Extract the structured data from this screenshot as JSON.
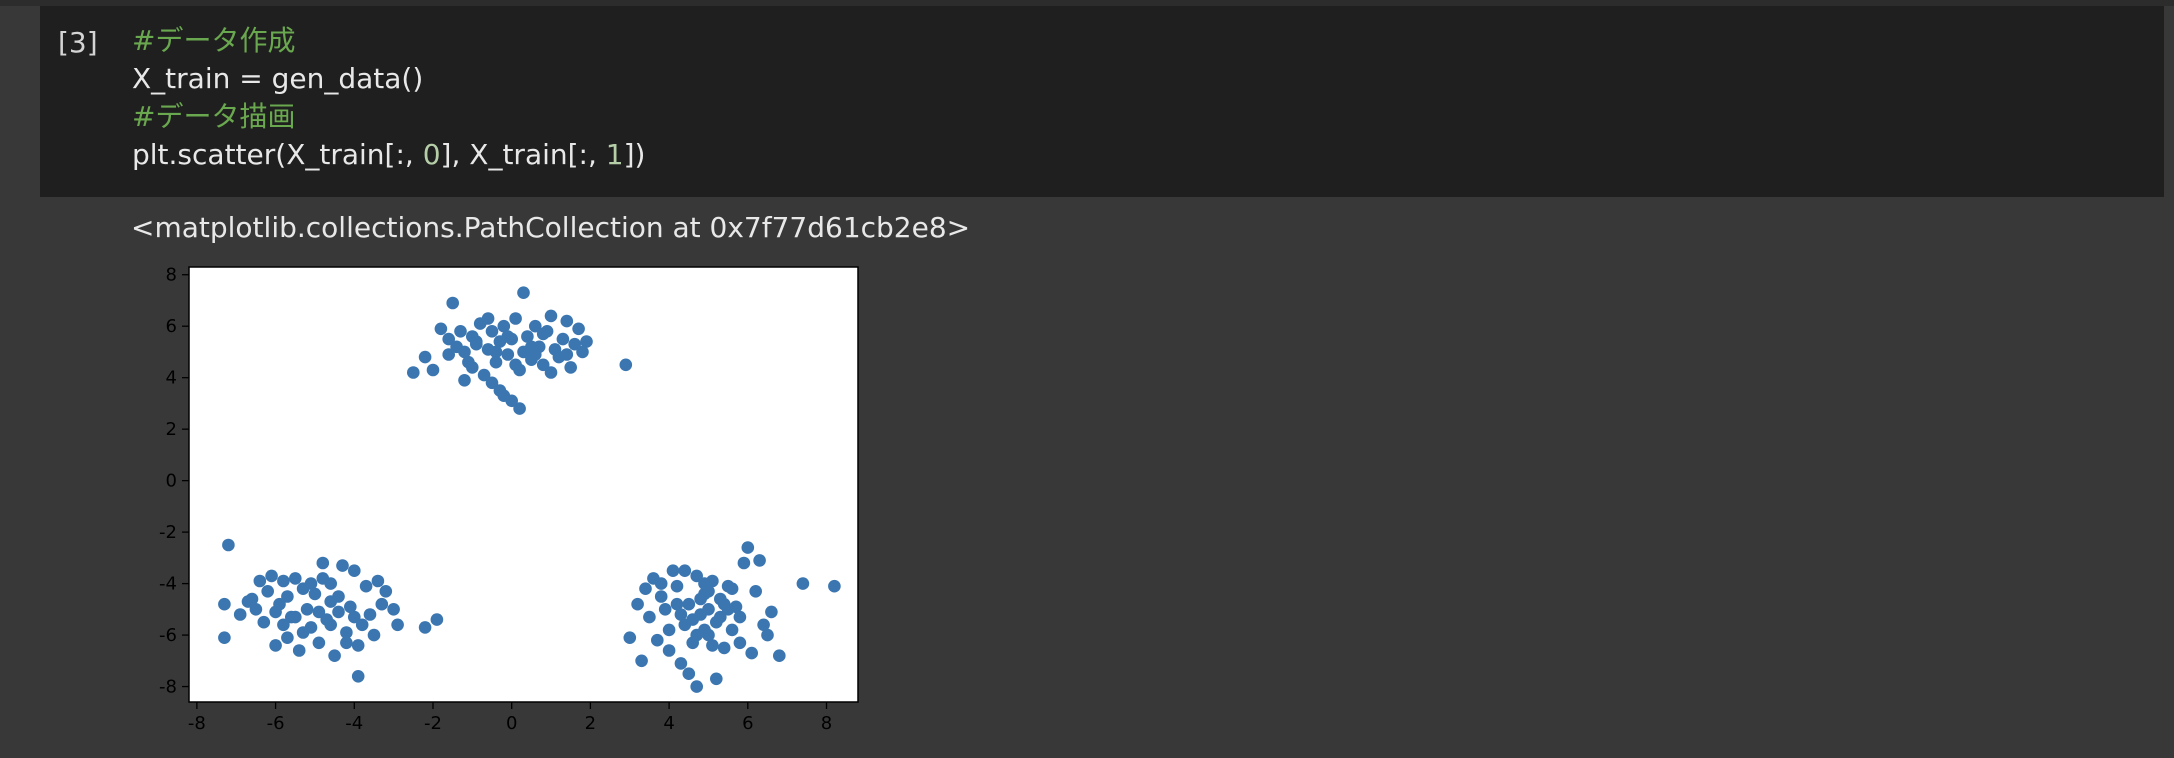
{
  "cell": {
    "execution_count": "[3]",
    "code_lines": [
      {
        "parts": [
          {
            "text": "#データ作成",
            "kind": "comment"
          }
        ]
      },
      {
        "parts": [
          {
            "text": "X_train = gen_data()",
            "kind": "plain"
          }
        ]
      },
      {
        "parts": [
          {
            "text": "#データ描画",
            "kind": "comment"
          }
        ]
      },
      {
        "parts": [
          {
            "text": "plt.scatter(X_train[:, ",
            "kind": "plain"
          },
          {
            "text": "0",
            "kind": "num"
          },
          {
            "text": "], X_train[:, ",
            "kind": "plain"
          },
          {
            "text": "1",
            "kind": "num"
          },
          {
            "text": "])",
            "kind": "plain"
          }
        ]
      }
    ]
  },
  "output": {
    "text": "<matplotlib.collections.PathCollection at 0x7f77d61cb2e8>"
  },
  "colors": {
    "marker": "#3b76b0",
    "comment": "#6aa84f",
    "number": "#b5cea8",
    "background": "#383838",
    "cell_background": "#1f1f1f"
  },
  "chart_data": {
    "type": "scatter",
    "xlim": [
      -8.2,
      8.8
    ],
    "ylim": [
      -8.6,
      8.3
    ],
    "xticks": [
      -8,
      -6,
      -4,
      -2,
      0,
      2,
      4,
      6,
      8
    ],
    "yticks": [
      -8,
      -6,
      -4,
      -2,
      0,
      2,
      4,
      6,
      8
    ],
    "grid": false,
    "series": [
      {
        "points": [
          [
            -2.5,
            4.2
          ],
          [
            -2.2,
            4.8
          ],
          [
            -2.0,
            4.3
          ],
          [
            -1.8,
            5.9
          ],
          [
            -1.6,
            5.5
          ],
          [
            -1.5,
            6.9
          ],
          [
            -1.4,
            5.2
          ],
          [
            -1.3,
            5.8
          ],
          [
            -1.2,
            5.0
          ],
          [
            -1.1,
            4.6
          ],
          [
            -1.0,
            5.6
          ],
          [
            -0.9,
            5.3
          ],
          [
            -0.8,
            6.1
          ],
          [
            -0.7,
            4.1
          ],
          [
            -0.6,
            5.1
          ],
          [
            -0.5,
            5.8
          ],
          [
            -0.4,
            4.6
          ],
          [
            -0.3,
            5.4
          ],
          [
            -0.2,
            6.0
          ],
          [
            -0.1,
            4.9
          ],
          [
            0.0,
            5.5
          ],
          [
            0.1,
            6.3
          ],
          [
            0.2,
            4.3
          ],
          [
            0.3,
            5.0
          ],
          [
            0.4,
            5.6
          ],
          [
            0.5,
            4.7
          ],
          [
            0.6,
            6.0
          ],
          [
            0.7,
            5.2
          ],
          [
            0.8,
            4.5
          ],
          [
            0.9,
            5.8
          ],
          [
            1.0,
            6.4
          ],
          [
            1.1,
            5.1
          ],
          [
            1.2,
            4.8
          ],
          [
            1.3,
            5.5
          ],
          [
            1.4,
            6.2
          ],
          [
            1.5,
            4.4
          ],
          [
            1.6,
            5.3
          ],
          [
            1.7,
            5.9
          ],
          [
            1.8,
            5.0
          ],
          [
            -0.5,
            3.8
          ],
          [
            -0.3,
            3.5
          ],
          [
            0.0,
            3.1
          ],
          [
            0.2,
            2.8
          ],
          [
            -0.2,
            3.3
          ],
          [
            0.3,
            7.3
          ],
          [
            -0.6,
            6.3
          ],
          [
            0.8,
            5.7
          ],
          [
            -1.0,
            4.4
          ],
          [
            1.0,
            4.2
          ],
          [
            -0.9,
            5.4
          ],
          [
            0.5,
            5.2
          ],
          [
            -0.1,
            5.6
          ],
          [
            2.9,
            4.5
          ],
          [
            -1.2,
            3.9
          ],
          [
            1.9,
            5.4
          ],
          [
            0.6,
            4.9
          ],
          [
            -0.4,
            5.0
          ],
          [
            0.1,
            4.5
          ],
          [
            -1.6,
            4.9
          ],
          [
            1.4,
            4.9
          ],
          [
            -7.2,
            -2.5
          ],
          [
            -7.3,
            -4.8
          ],
          [
            -7.3,
            -6.1
          ],
          [
            -6.9,
            -5.2
          ],
          [
            -6.6,
            -4.6
          ],
          [
            -6.5,
            -5.0
          ],
          [
            -6.4,
            -3.9
          ],
          [
            -6.3,
            -5.5
          ],
          [
            -6.2,
            -4.3
          ],
          [
            -6.1,
            -3.7
          ],
          [
            -6.0,
            -5.1
          ],
          [
            -5.9,
            -4.8
          ],
          [
            -5.8,
            -5.6
          ],
          [
            -5.7,
            -4.5
          ],
          [
            -5.6,
            -5.3
          ],
          [
            -5.5,
            -3.8
          ],
          [
            -5.4,
            -6.6
          ],
          [
            -5.3,
            -4.2
          ],
          [
            -5.2,
            -5.0
          ],
          [
            -5.1,
            -5.7
          ],
          [
            -5.0,
            -4.4
          ],
          [
            -4.9,
            -6.3
          ],
          [
            -4.8,
            -3.8
          ],
          [
            -4.7,
            -5.4
          ],
          [
            -4.6,
            -4.7
          ],
          [
            -4.5,
            -6.8
          ],
          [
            -4.4,
            -5.1
          ],
          [
            -4.3,
            -3.3
          ],
          [
            -4.2,
            -5.9
          ],
          [
            -4.1,
            -4.9
          ],
          [
            -4.0,
            -3.5
          ],
          [
            -3.9,
            -6.4
          ],
          [
            -3.8,
            -5.6
          ],
          [
            -3.7,
            -4.1
          ],
          [
            -3.6,
            -5.2
          ],
          [
            -3.5,
            -6.0
          ],
          [
            -3.4,
            -3.9
          ],
          [
            -3.2,
            -4.3
          ],
          [
            -3.0,
            -5.0
          ],
          [
            -2.9,
            -5.6
          ],
          [
            -2.2,
            -5.7
          ],
          [
            -1.9,
            -5.4
          ],
          [
            -3.9,
            -7.6
          ],
          [
            -4.8,
            -3.2
          ],
          [
            -4.6,
            -5.6
          ],
          [
            -5.1,
            -4.0
          ],
          [
            -4.4,
            -4.5
          ],
          [
            -5.7,
            -6.1
          ],
          [
            -4.9,
            -5.1
          ],
          [
            -4.2,
            -6.3
          ],
          [
            -5.3,
            -5.9
          ],
          [
            -6.7,
            -4.7
          ],
          [
            -6.0,
            -6.4
          ],
          [
            -3.3,
            -4.8
          ],
          [
            -5.8,
            -3.9
          ],
          [
            -4.6,
            -4.0
          ],
          [
            -5.5,
            -5.3
          ],
          [
            -4.0,
            -5.3
          ],
          [
            3.0,
            -6.1
          ],
          [
            3.2,
            -4.8
          ],
          [
            3.3,
            -7.0
          ],
          [
            3.4,
            -4.2
          ],
          [
            3.5,
            -5.3
          ],
          [
            3.6,
            -3.8
          ],
          [
            3.7,
            -6.2
          ],
          [
            3.8,
            -4.5
          ],
          [
            3.9,
            -5.0
          ],
          [
            4.0,
            -6.6
          ],
          [
            4.1,
            -3.5
          ],
          [
            4.2,
            -4.1
          ],
          [
            4.3,
            -7.1
          ],
          [
            4.4,
            -5.6
          ],
          [
            4.5,
            -4.8
          ],
          [
            4.6,
            -6.3
          ],
          [
            4.7,
            -3.7
          ],
          [
            4.8,
            -5.2
          ],
          [
            4.9,
            -4.4
          ],
          [
            5.0,
            -6.0
          ],
          [
            5.1,
            -3.9
          ],
          [
            5.2,
            -5.5
          ],
          [
            5.3,
            -4.6
          ],
          [
            5.4,
            -6.5
          ],
          [
            5.5,
            -4.1
          ],
          [
            5.6,
            -5.8
          ],
          [
            5.7,
            -4.9
          ],
          [
            5.8,
            -5.3
          ],
          [
            5.9,
            -3.2
          ],
          [
            6.0,
            -2.6
          ],
          [
            6.1,
            -6.7
          ],
          [
            6.2,
            -4.3
          ],
          [
            6.3,
            -3.1
          ],
          [
            6.4,
            -5.6
          ],
          [
            6.5,
            -6.0
          ],
          [
            6.6,
            -5.1
          ],
          [
            6.8,
            -6.8
          ],
          [
            7.4,
            -4.0
          ],
          [
            8.2,
            -4.1
          ],
          [
            4.7,
            -8.0
          ],
          [
            5.2,
            -7.7
          ],
          [
            4.5,
            -7.5
          ],
          [
            4.9,
            -4.0
          ],
          [
            5.0,
            -5.0
          ],
          [
            4.8,
            -4.6
          ],
          [
            5.3,
            -5.3
          ],
          [
            4.6,
            -5.4
          ],
          [
            5.1,
            -6.4
          ],
          [
            4.2,
            -4.8
          ],
          [
            5.6,
            -4.2
          ],
          [
            4.0,
            -5.8
          ],
          [
            4.4,
            -3.5
          ],
          [
            5.8,
            -6.3
          ],
          [
            3.8,
            -4.0
          ],
          [
            4.9,
            -5.8
          ],
          [
            5.4,
            -4.8
          ],
          [
            5.0,
            -4.3
          ],
          [
            4.3,
            -5.2
          ],
          [
            4.7,
            -6.0
          ],
          [
            5.5,
            -5.0
          ]
        ]
      }
    ]
  }
}
